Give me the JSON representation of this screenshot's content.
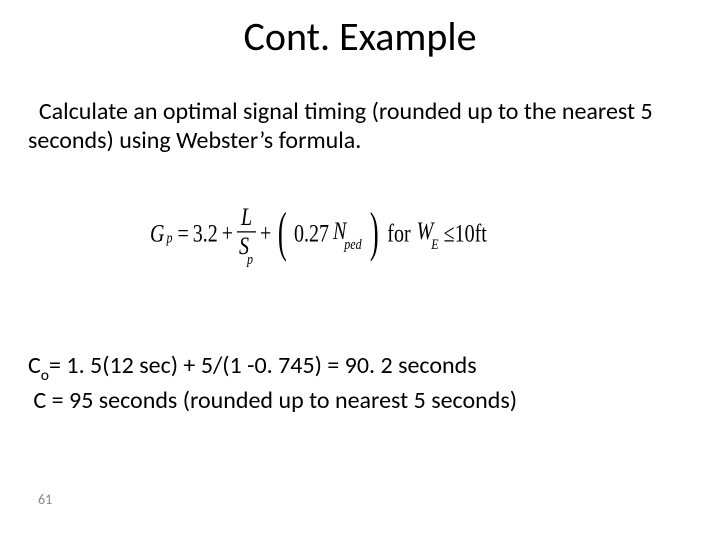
{
  "title": "Cont. Example",
  "body": "  Calculate an optimal signal timing (rounded up to the nearest 5 seconds) using Webster’s formula.",
  "formula": {
    "lhs_var": "G",
    "lhs_sub": "p",
    "eq": "=",
    "term1": "3.2",
    "plus1": "+",
    "frac1_num": "L",
    "frac1_den_var": "S",
    "frac1_den_sub": "p",
    "plus2": "+",
    "lparen": "(",
    "coef": "0.27",
    "nvar": "N",
    "nsub": "ped",
    "rparen": ")",
    "for": "for",
    "wvar": "W",
    "wsub": "E",
    "cond": "≤10ft"
  },
  "result_line1_pre": "C",
  "result_line1_sub": "o",
  "result_line1_post": "= 1. 5(12 sec) + 5/(1 -0. 745) = 90. 2 seconds",
  "result_line2": " C = 95 seconds (rounded up to nearest 5 seconds)",
  "page_number": "61"
}
